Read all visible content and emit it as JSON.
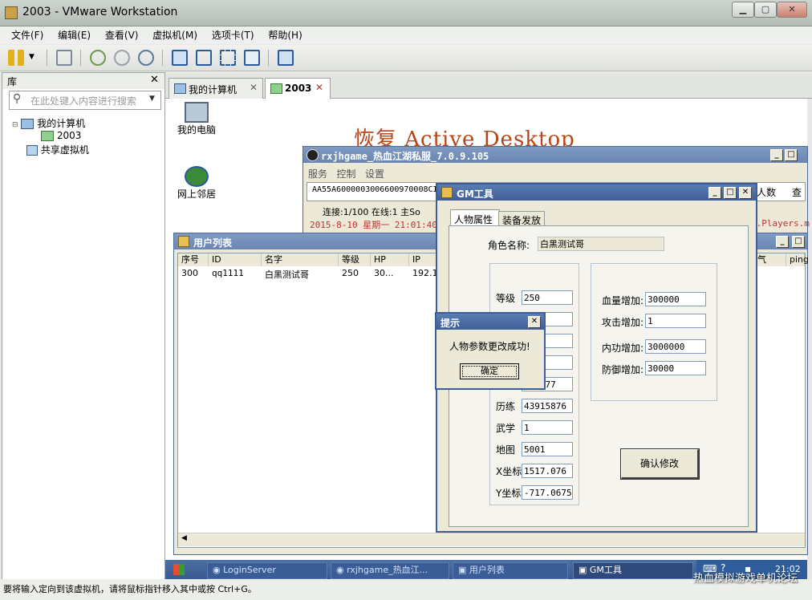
{
  "vm": {
    "title": "2003 - VMware Workstation",
    "menu": [
      "文件(F)",
      "编辑(E)",
      "查看(V)",
      "虚拟机(M)",
      "选项卡(T)",
      "帮助(H)"
    ],
    "library": {
      "title": "库",
      "search_placeholder": "在此处键入内容进行搜索",
      "tree": [
        "我的计算机",
        "2003",
        "共享虚拟机"
      ]
    },
    "tabs": [
      "我的计算机",
      "2003"
    ],
    "status_text": "要将输入定向到该虚拟机，请将鼠标指针移入其中或按 Ctrl+G。"
  },
  "desktop": {
    "icons": [
      "我的电脑",
      "网上邻居"
    ],
    "overlay": "恢复 Active Desktop"
  },
  "server_window": {
    "title": "rxjhgame_热血江湖私服_7.0.9.105",
    "menu": [
      "服务",
      "控制",
      "设置"
    ],
    "hex_line": "AA55A6000003006600970008CI",
    "conn_line": "连接:1/100  在线:1  主So",
    "log_line": "2015-8-10  星期一  21:01:40",
    "log_right": "r.Players.m",
    "right_label": "人数",
    "right_button": "查"
  },
  "user_list": {
    "title": "用户列表",
    "columns": [
      "序号",
      "ID",
      "名字",
      "等级",
      "HP",
      "IP"
    ],
    "right_columns": [
      "气",
      "ping"
    ],
    "rows": [
      [
        "300",
        "qq1111",
        "白黑测试哥",
        "250",
        "30...",
        "192.1"
      ]
    ]
  },
  "gm_tool": {
    "title": "GM工具",
    "tabs": [
      "人物属性",
      "装备发放"
    ],
    "char_name_label": "角色名称:",
    "char_name": "白黑测试哥",
    "left_fields": [
      {
        "label": "等级",
        "value": "250"
      },
      {
        "label": "",
        "value": ""
      },
      {
        "label": "",
        "value": ""
      },
      {
        "label": "",
        "value": ""
      },
      {
        "label": "",
        "value": "823077"
      },
      {
        "label": "历练",
        "value": "43915876"
      },
      {
        "label": "武学",
        "value": "1"
      },
      {
        "label": "地图",
        "value": "5001"
      },
      {
        "label": "X坐标",
        "value": "1517.076"
      },
      {
        "label": "Y坐标",
        "value": "-717.0675"
      }
    ],
    "right_fields": [
      {
        "label": "血量增加:",
        "value": "300000"
      },
      {
        "label": "攻击增加:",
        "value": "1"
      },
      {
        "label": "内功增加:",
        "value": "3000000"
      },
      {
        "label": "防御增加:",
        "value": "30000"
      }
    ],
    "confirm_button": "确认修改"
  },
  "dialog": {
    "title": "提示",
    "message": "人物参数更改成功!",
    "ok": "确定"
  },
  "guest_taskbar": {
    "items": [
      "LoginServer",
      "rxjhgame_热血江...",
      "用户列表",
      "GM工具"
    ],
    "clock": "21:02"
  },
  "watermark": "热血模拟游戏单机论坛"
}
